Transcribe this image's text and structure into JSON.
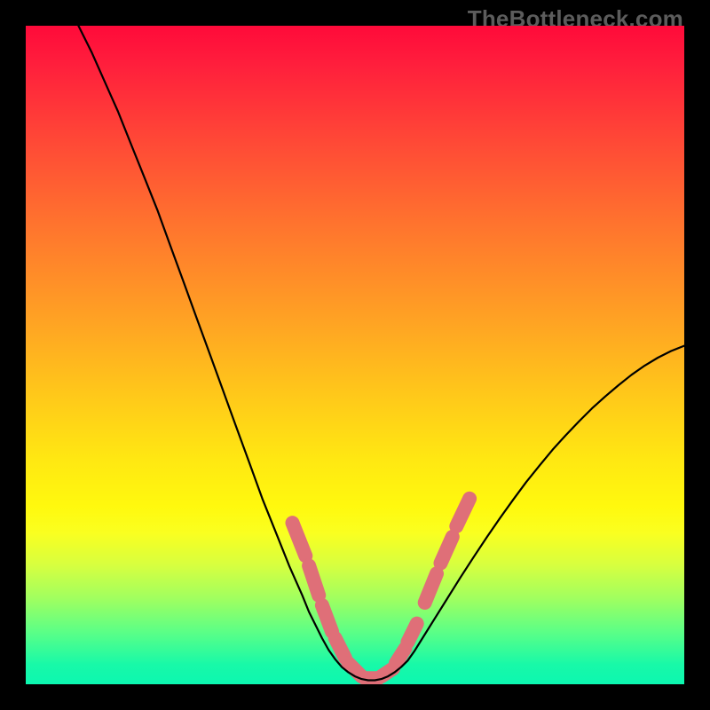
{
  "chart_data": {
    "type": "line",
    "title": "",
    "xlabel": "",
    "ylabel": "",
    "xlim": [
      0,
      100
    ],
    "ylim": [
      0,
      100
    ],
    "watermark": "TheBottleneck.com",
    "curve": {
      "name": "bottleneck-curve",
      "x": [
        8,
        10,
        12,
        14,
        16,
        18,
        20,
        22,
        24,
        26,
        28,
        30,
        32,
        34,
        36,
        38,
        40,
        42,
        43,
        44,
        45,
        46,
        47,
        48,
        49,
        50,
        51,
        52,
        53,
        54,
        55,
        56,
        57,
        58,
        59,
        60,
        62,
        64,
        66,
        68,
        70,
        72,
        74,
        76,
        78,
        80,
        82,
        84,
        86,
        88,
        90,
        92,
        94,
        96,
        98,
        100
      ],
      "y": [
        100,
        96,
        91.5,
        87,
        82,
        77,
        72,
        66.5,
        61,
        55.5,
        50,
        44.5,
        39,
        33.5,
        28,
        23,
        18,
        13.5,
        11,
        9,
        7,
        5.2,
        3.8,
        2.6,
        1.8,
        1.2,
        0.8,
        0.6,
        0.6,
        0.8,
        1.2,
        1.8,
        2.6,
        3.6,
        5,
        6.6,
        9.8,
        13,
        16.2,
        19.3,
        22.3,
        25.2,
        28,
        30.7,
        33.2,
        35.6,
        37.8,
        39.9,
        41.9,
        43.7,
        45.4,
        47,
        48.4,
        49.6,
        50.6,
        51.4
      ]
    },
    "rope": {
      "color": "#df6f78",
      "segments": [
        {
          "x0": 40.5,
          "y0": 24.5,
          "x1": 42.5,
          "y1": 19.5
        },
        {
          "x0": 43.0,
          "y0": 18.0,
          "x1": 44.5,
          "y1": 13.5
        },
        {
          "x0": 45.0,
          "y0": 12.0,
          "x1": 46.5,
          "y1": 8.0
        },
        {
          "x0": 47.0,
          "y0": 7.0,
          "x1": 48.5,
          "y1": 4.0
        },
        {
          "x0": 49.0,
          "y0": 3.2,
          "x1": 51.0,
          "y1": 1.2
        },
        {
          "x0": 51.5,
          "y0": 0.9,
          "x1": 53.5,
          "y1": 0.9
        },
        {
          "x0": 54.0,
          "y0": 1.2,
          "x1": 55.8,
          "y1": 2.4
        },
        {
          "x0": 56.2,
          "y0": 3.2,
          "x1": 57.6,
          "y1": 5.4
        },
        {
          "x0": 58.0,
          "y0": 6.4,
          "x1": 59.4,
          "y1": 9.2
        },
        {
          "x0": 60.6,
          "y0": 12.4,
          "x1": 62.4,
          "y1": 16.8
        },
        {
          "x0": 63.0,
          "y0": 18.4,
          "x1": 64.8,
          "y1": 22.4
        },
        {
          "x0": 65.4,
          "y0": 24.0,
          "x1": 67.4,
          "y1": 28.2
        }
      ]
    }
  }
}
